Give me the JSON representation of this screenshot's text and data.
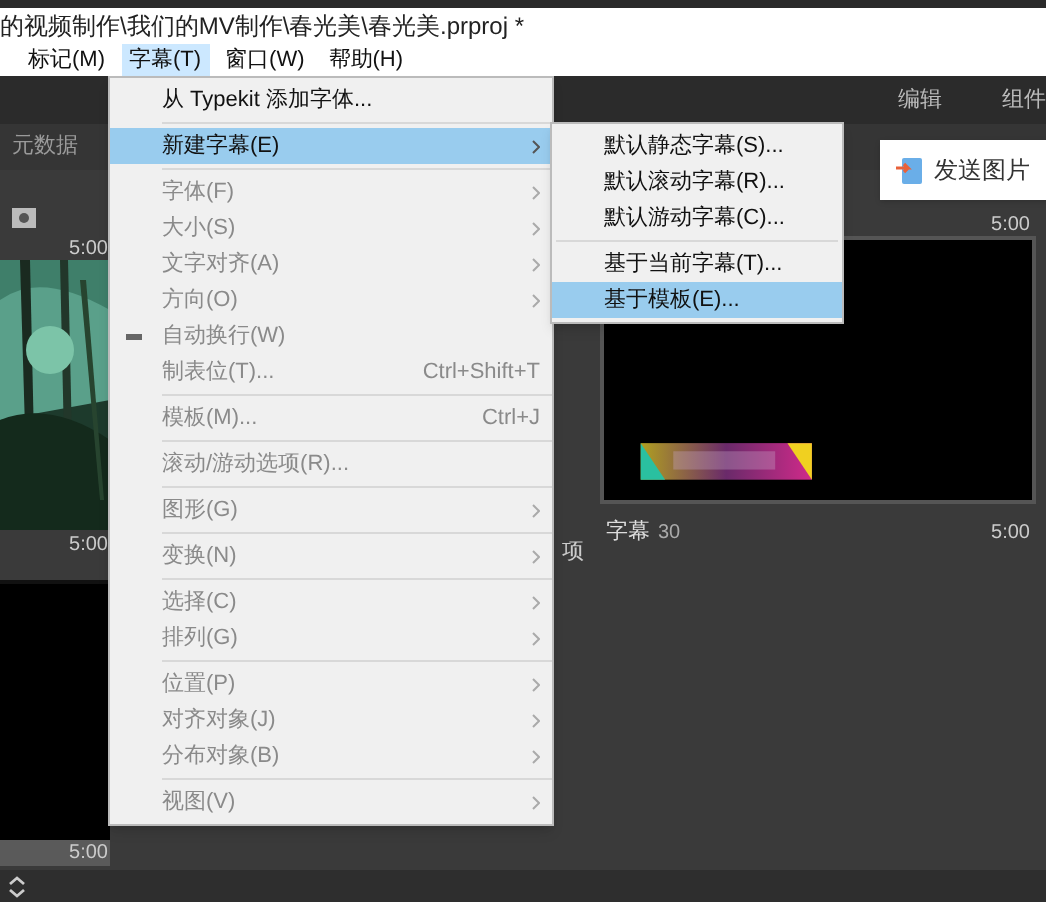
{
  "window": {
    "title": "的视频制作\\我们的MV制作\\春光美\\春光美.prproj *"
  },
  "menubar": [
    {
      "label": "标记(M)",
      "selected": false
    },
    {
      "label": "字幕(T)",
      "selected": true
    },
    {
      "label": "窗口(W)",
      "selected": false
    },
    {
      "label": "帮助(H)",
      "selected": false
    }
  ],
  "workspaces": [
    "编辑",
    "组件"
  ],
  "panel_tab": "元数据",
  "send_popup": {
    "label": "发送图片"
  },
  "bins": [
    {
      "duration_top": "5:00",
      "duration_bottom": "5:00",
      "kind": "picture"
    },
    {
      "duration_bottom": "5:00",
      "kind": "black"
    }
  ],
  "clip": {
    "duration_top": "5:00",
    "name": "字幕",
    "number": "30",
    "duration_bottom": "5:00",
    "kind": "picture"
  },
  "hidden_label": "项",
  "menu": {
    "groups": [
      [
        {
          "label": "从 Typekit 添加字体...",
          "disabled": false,
          "submenu": false,
          "checked": false,
          "selected": false
        }
      ],
      [
        {
          "label": "新建字幕(E)",
          "disabled": false,
          "submenu": true,
          "checked": false,
          "selected": true
        }
      ],
      [
        {
          "label": "字体(F)",
          "disabled": true,
          "submenu": true,
          "checked": false,
          "selected": false
        },
        {
          "label": "大小(S)",
          "disabled": true,
          "submenu": true,
          "checked": false,
          "selected": false
        },
        {
          "label": "文字对齐(A)",
          "disabled": true,
          "submenu": true,
          "checked": false,
          "selected": false
        },
        {
          "label": "方向(O)",
          "disabled": true,
          "submenu": true,
          "checked": false,
          "selected": false
        },
        {
          "label": "自动换行(W)",
          "disabled": true,
          "submenu": false,
          "checked": true,
          "selected": false
        },
        {
          "label": "制表位(T)...",
          "shortcut": "Ctrl+Shift+T",
          "disabled": true,
          "submenu": false,
          "checked": false,
          "selected": false
        }
      ],
      [
        {
          "label": "模板(M)...",
          "shortcut": "Ctrl+J",
          "disabled": true,
          "submenu": false,
          "checked": false,
          "selected": false
        }
      ],
      [
        {
          "label": "滚动/游动选项(R)...",
          "disabled": true,
          "submenu": false,
          "checked": false,
          "selected": false
        }
      ],
      [
        {
          "label": "图形(G)",
          "disabled": true,
          "submenu": true,
          "checked": false,
          "selected": false
        }
      ],
      [
        {
          "label": "变换(N)",
          "disabled": true,
          "submenu": true,
          "checked": false,
          "selected": false
        }
      ],
      [
        {
          "label": "选择(C)",
          "disabled": true,
          "submenu": true,
          "checked": false,
          "selected": false
        },
        {
          "label": "排列(G)",
          "disabled": true,
          "submenu": true,
          "checked": false,
          "selected": false
        }
      ],
      [
        {
          "label": "位置(P)",
          "disabled": true,
          "submenu": true,
          "checked": false,
          "selected": false
        },
        {
          "label": "对齐对象(J)",
          "disabled": true,
          "submenu": true,
          "checked": false,
          "selected": false
        },
        {
          "label": "分布对象(B)",
          "disabled": true,
          "submenu": true,
          "checked": false,
          "selected": false
        }
      ],
      [
        {
          "label": "视图(V)",
          "disabled": true,
          "submenu": true,
          "checked": false,
          "selected": false
        }
      ]
    ]
  },
  "submenu": {
    "groups": [
      [
        {
          "label": "默认静态字幕(S)...",
          "selected": false
        },
        {
          "label": "默认滚动字幕(R)...",
          "selected": false
        },
        {
          "label": "默认游动字幕(C)...",
          "selected": false
        }
      ],
      [
        {
          "label": "基于当前字幕(T)...",
          "selected": false
        },
        {
          "label": "基于模板(E)...",
          "selected": true
        }
      ]
    ]
  }
}
